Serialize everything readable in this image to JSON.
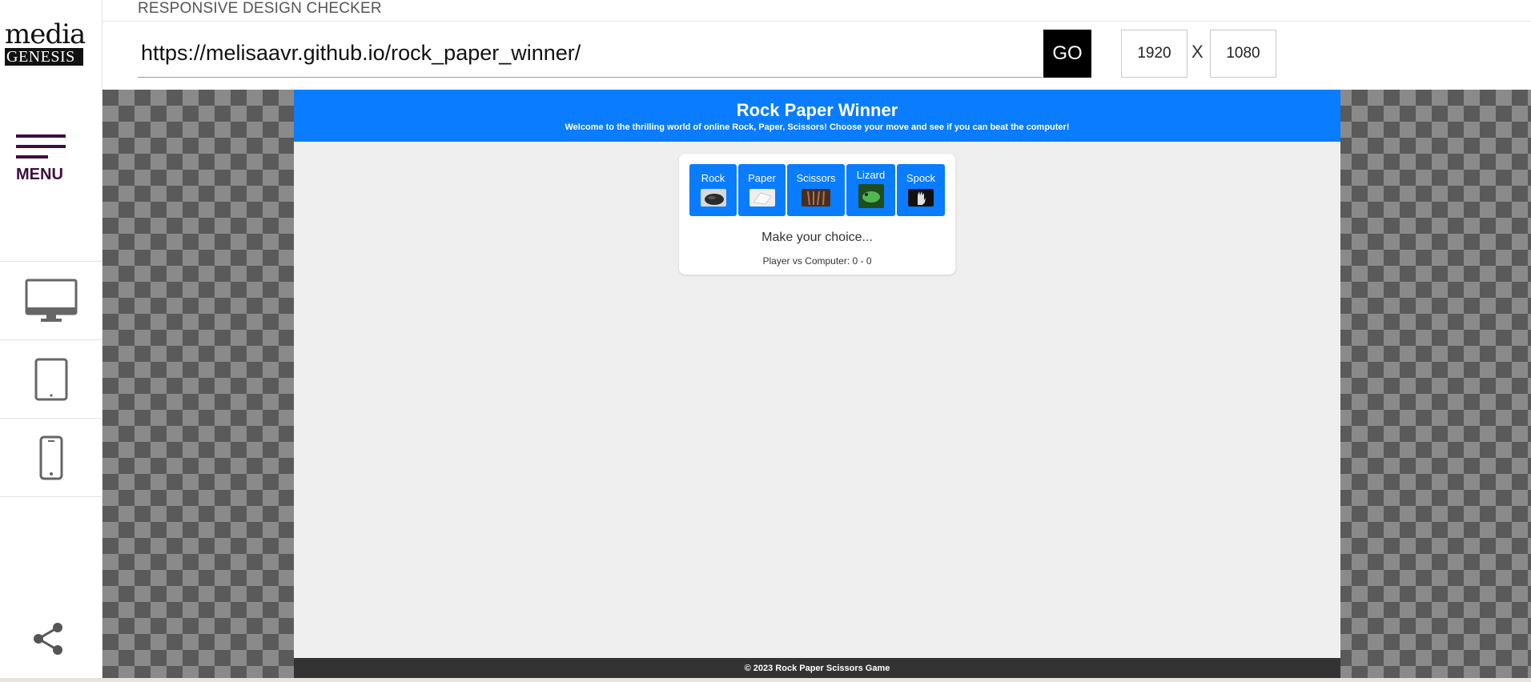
{
  "logo": {
    "top": "media",
    "bottom": "GENESIS"
  },
  "sidebar": {
    "menu_label": "MENU",
    "devices": [
      {
        "name": "desktop",
        "icon": "desktop-icon"
      },
      {
        "name": "tablet",
        "icon": "tablet-icon"
      },
      {
        "name": "mobile",
        "icon": "mobile-icon"
      }
    ],
    "share_icon": "share-icon"
  },
  "app": {
    "title": "RESPONSIVE DESIGN CHECKER"
  },
  "toolbar": {
    "url": "https://melisaavr.github.io/rock_paper_winner/",
    "go_label": "GO",
    "width": "1920",
    "x_label": "X",
    "height": "1080"
  },
  "site": {
    "title": "Rock Paper Winner",
    "subtitle": "Welcome to the thrilling world of online Rock, Paper, Scissors! Choose your move and see if you can beat the computer!",
    "choices": [
      {
        "label": "Rock"
      },
      {
        "label": "Paper"
      },
      {
        "label": "Scissors"
      },
      {
        "label": "Lizard"
      },
      {
        "label": "Spock"
      }
    ],
    "status": "Make your choice...",
    "score": "Player vs Computer: 0 - 0",
    "footer": "© 2023 Rock Paper Scissors Game"
  },
  "colors": {
    "accent": "#0a7cff",
    "menu": "#3d0f3d",
    "footer": "#333333"
  }
}
